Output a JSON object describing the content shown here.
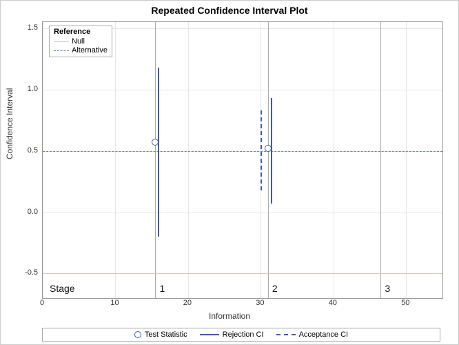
{
  "chart_data": {
    "type": "scatter",
    "title": "Repeated Confidence Interval Plot",
    "xlabel": "Information",
    "ylabel": "Confidence Interval",
    "xlim": [
      0,
      55
    ],
    "ylim": [
      -0.7,
      1.55
    ],
    "x_ticks": [
      0,
      10,
      20,
      30,
      40,
      50
    ],
    "y_ticks": [
      -0.5,
      0.0,
      0.5,
      1.0,
      1.5
    ],
    "reference_lines": {
      "label": "Reference",
      "null": {
        "y": [
          -0.5
        ],
        "label": "Null"
      },
      "alternative": {
        "y": [
          0.5
        ],
        "label": "Alternative"
      }
    },
    "stages": [
      {
        "stage": 1,
        "x": 15.5
      },
      {
        "stage": 2,
        "x": 31.0
      },
      {
        "stage": 3,
        "x": 46.5
      }
    ],
    "series": [
      {
        "name": "Test Statistic",
        "type": "marker",
        "points": [
          {
            "x": 15.5,
            "y": 0.57
          },
          {
            "x": 31.0,
            "y": 0.52
          }
        ]
      },
      {
        "name": "Rejection CI",
        "type": "ci_solid",
        "intervals": [
          {
            "x": 15.9,
            "lo": -0.2,
            "hi": 1.18
          },
          {
            "x": 31.5,
            "lo": 0.07,
            "hi": 0.93
          }
        ]
      },
      {
        "name": "Acceptance CI",
        "type": "ci_dashed",
        "intervals": [
          {
            "x": 30.0,
            "lo": 0.18,
            "hi": 0.83
          }
        ]
      }
    ],
    "stage_label": "Stage",
    "legend_series": [
      "Test Statistic",
      "Rejection CI",
      "Acceptance CI"
    ]
  }
}
